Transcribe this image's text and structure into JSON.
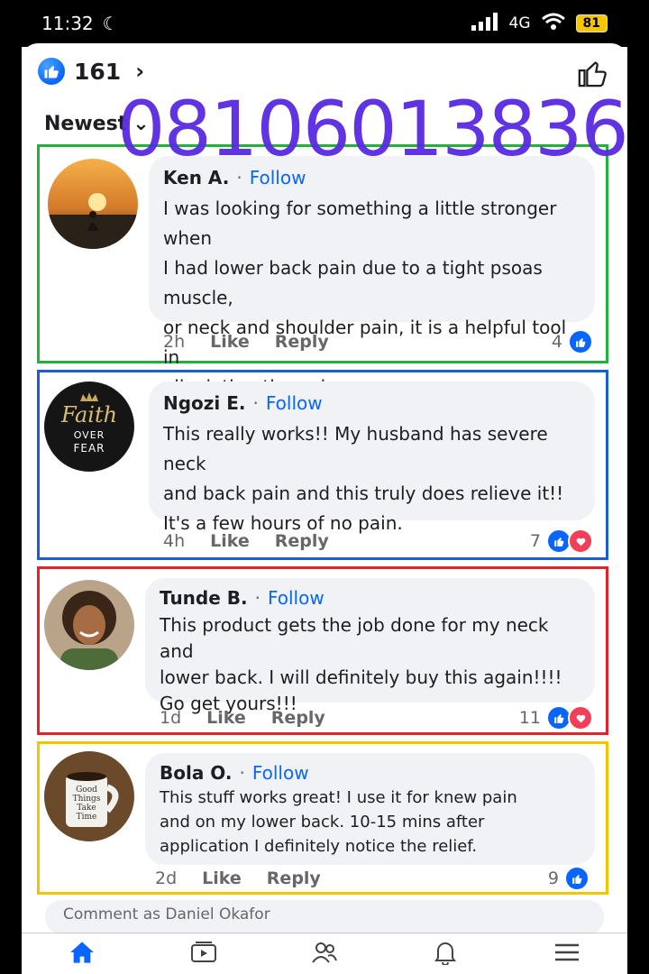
{
  "statusbar": {
    "time": "11:32",
    "network": "4G",
    "battery": "81"
  },
  "header": {
    "reaction_count": "161",
    "sort_label": "Newest"
  },
  "watermark": "08106013836",
  "comments": [
    {
      "name": "Ken A.",
      "follow": "Follow",
      "text_lines": [
        "I was looking for something a little stronger when",
        "I had lower back pain due to a tight psoas muscle,",
        "or neck and shoulder pain, it is a helpful tool in",
        "alleviating the pain."
      ],
      "time": "2h",
      "like": "Like",
      "reply": "Reply",
      "reactions": "4",
      "border_color": "#1fb33a"
    },
    {
      "name": "Ngozi E.",
      "follow": "Follow",
      "text_lines": [
        "This really works!! My husband has severe neck",
        "and back pain and this truly does relieve it!!",
        "It's a few hours of no pain."
      ],
      "time": "4h",
      "like": "Like",
      "reply": "Reply",
      "reactions": "7",
      "border_color": "#1a5fd1",
      "avatar_text": [
        "Faith",
        "OVER",
        "FEAR"
      ]
    },
    {
      "name": "Tunde B.",
      "follow": "Follow",
      "text_lines": [
        "This product gets the job done for my neck and",
        "lower back. I will definitely buy this again!!!!",
        "Go get yours!!!"
      ],
      "time": "1d",
      "like": "Like",
      "reply": "Reply",
      "reactions": "11",
      "border_color": "#e3222b"
    },
    {
      "name": "Bola O.",
      "follow": "Follow",
      "text_lines": [
        "This stuff works great! I use it for knew pain",
        "and on my lower back. 10-15 mins after",
        "application I definitely notice the relief."
      ],
      "time": "2d",
      "like": "Like",
      "reply": "Reply",
      "reactions": "9",
      "border_color": "#f2c500",
      "avatar_text": [
        "Good",
        "Things",
        "Take",
        "Time"
      ]
    }
  ],
  "comment_input": {
    "placeholder": "Comment as Daniel Okafor"
  },
  "colors": {
    "accent": "#0866ff",
    "love": "#f33e58",
    "bubble": "#f0f2f5"
  }
}
